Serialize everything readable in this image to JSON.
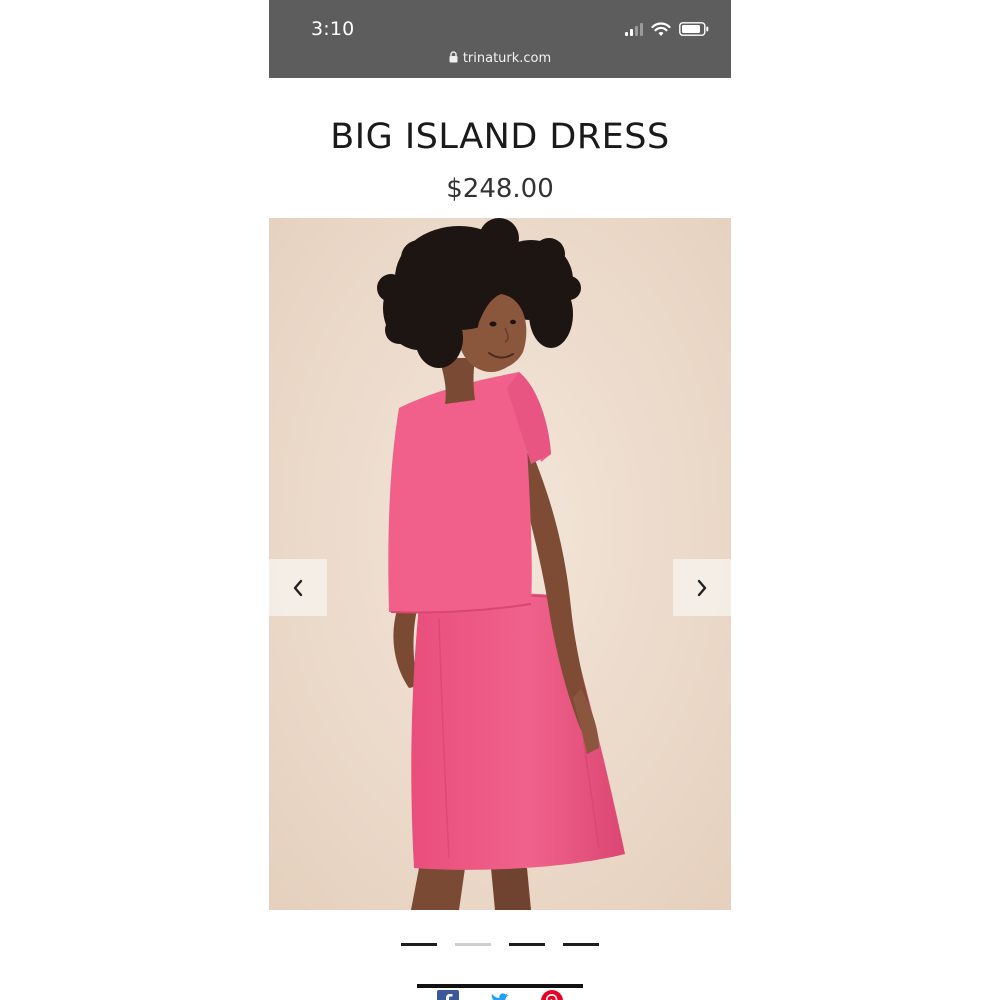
{
  "status_bar": {
    "time": "3:10",
    "url": "trinaturk.com"
  },
  "product": {
    "title": "BIG ISLAND DRESS",
    "price": "$248.00",
    "image_alt": "Model in pink dress",
    "dress_color": "#ef5b86"
  },
  "carousel": {
    "prev_icon": "chevron-left-icon",
    "next_icon": "chevron-right-icon",
    "slide_count": 4,
    "active_slide": 1
  },
  "share": {
    "icons": [
      "facebook-icon",
      "twitter-icon",
      "pinterest-icon"
    ],
    "colors": [
      "#3b5998",
      "#1da1f2",
      "#e60023"
    ]
  }
}
